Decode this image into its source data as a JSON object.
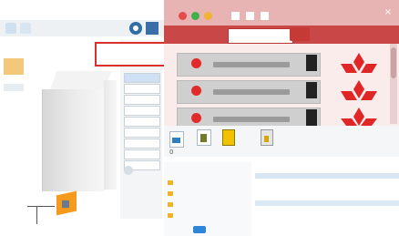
{
  "app": {
    "title": "",
    "toolbar_icons": [
      "save-icon",
      "grid-icon",
      "gear-icon",
      "layout-icon"
    ],
    "side_labels": [
      "",
      ""
    ]
  },
  "viewport": {
    "dimension_labels": [
      "",
      "",
      "",
      ""
    ],
    "model_color": "#e0e0e0",
    "accent_color": "#f39a1f"
  },
  "properties": {
    "fields": [
      "",
      "",
      "",
      "",
      "",
      "",
      "",
      "",
      "",
      "",
      "",
      ""
    ]
  },
  "popup": {
    "text": "",
    "border_color": "#d9302b"
  },
  "window": {
    "title": "",
    "close_label": "×",
    "search_label": "",
    "search_value": "",
    "go_label": "",
    "accent_color": "#c94747",
    "rows": [
      {
        "label": "",
        "status_color": "#e22a2a",
        "icon": "red-mark-icon"
      },
      {
        "label": "",
        "status_color": "#e22a2a",
        "icon": "red-mark-icon"
      },
      {
        "label": "",
        "status_color": "#e22a2a",
        "icon": "red-mark-icon"
      }
    ]
  },
  "browser": {
    "doc_icon_label": "0",
    "tree": [
      "",
      "",
      "",
      "",
      "",
      "",
      ""
    ],
    "list": [
      "",
      "",
      "",
      "",
      "",
      "",
      "",
      "",
      "",
      "",
      "",
      "",
      "",
      ""
    ]
  }
}
